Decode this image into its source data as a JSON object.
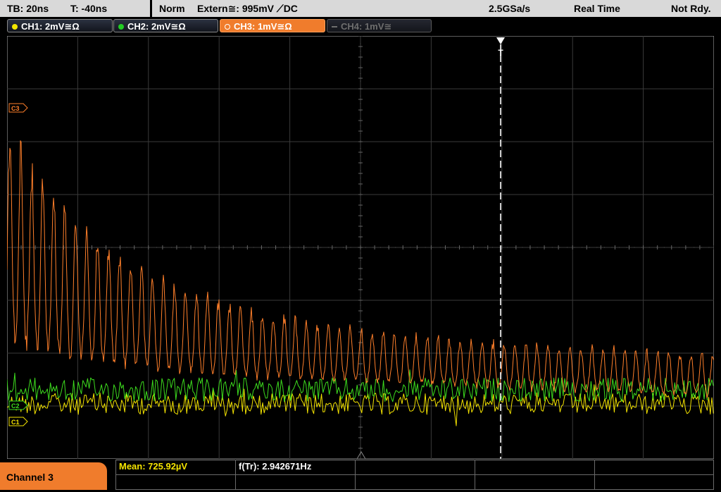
{
  "status_bar": {
    "timebase": "TB: 20ns",
    "trigger_time": "T: -40ns",
    "mode": "Norm",
    "trigger_source": "Extern≅: 995mV",
    "trigger_slope": "⟋DC",
    "sample_rate": "2.5GSa/s",
    "acq_mode": "Real Time",
    "state": "Not Rdy."
  },
  "channels": [
    {
      "label": "CH1: 2mV≅Ω",
      "color": "#f2e600",
      "active": false,
      "enabled": true
    },
    {
      "label": "CH2: 2mV≅Ω",
      "color": "#22cc22",
      "active": false,
      "enabled": true
    },
    {
      "label": "CH3: 1mV≅Ω",
      "color": "#f07c2c",
      "active": true,
      "enabled": true
    },
    {
      "label": "CH4: 1mV≅",
      "color": "#6e6e6e",
      "active": false,
      "enabled": false
    }
  ],
  "markers": {
    "ch3": "C3",
    "ch2": "C2",
    "ch1": "C1",
    "trigger": "T"
  },
  "traces": {
    "ch3_color": "#ff7f2a",
    "ch2_color": "#3ddc1e",
    "ch1_color": "#f5e400"
  },
  "bottom": {
    "channel_label": "Channel 3",
    "mean": "Mean: 725.92µV",
    "frequency": "f(Tr): 2.942671Hz"
  }
}
